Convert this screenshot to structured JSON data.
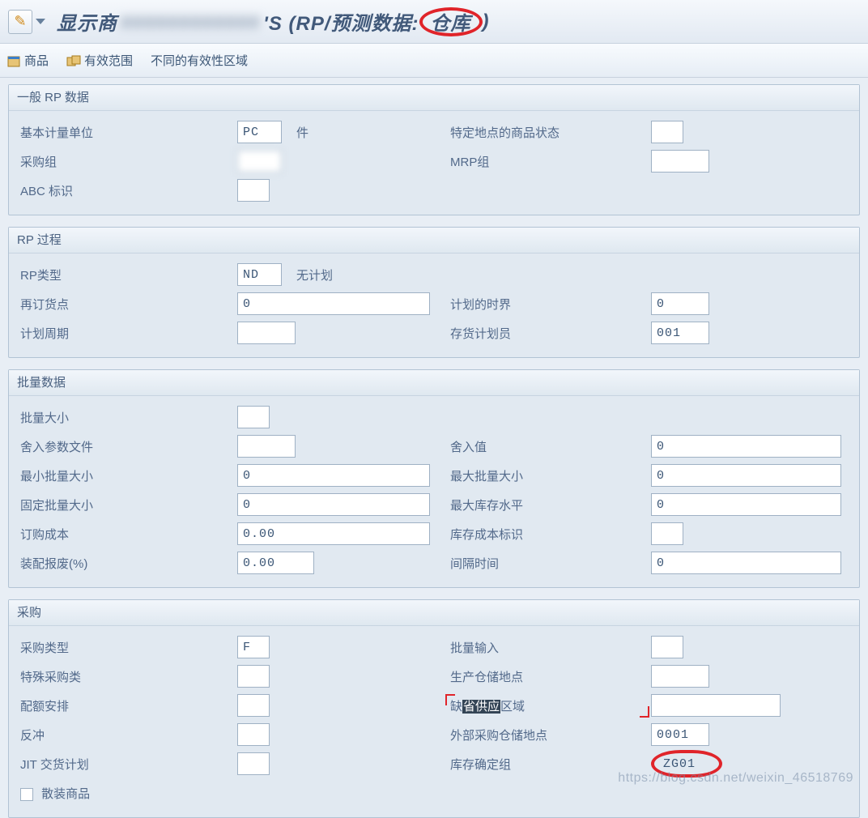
{
  "title": {
    "prefix": "显示商",
    "blurred": "xxxxxxxxxxxx",
    "suffix_before_circle": "'S (RP/预测数据: ",
    "circled": "仓库",
    "closing": ")"
  },
  "toolbar": {
    "product": "商品",
    "valid_range": "有效范围",
    "diff_validity": "不同的有效性区域"
  },
  "group_general": {
    "title": "一般 RP 数据",
    "base_uom_label": "基本计量单位",
    "base_uom_value": "PC",
    "base_uom_desc": "件",
    "site_status_label": "特定地点的商品状态",
    "site_status_value": "",
    "purch_group_label": "采购组",
    "purch_group_value": "",
    "mrp_group_label": "MRP组",
    "mrp_group_value": "",
    "abc_label": "ABC 标识",
    "abc_value": ""
  },
  "group_rp": {
    "title": "RP 过程",
    "rp_type_label": "RP类型",
    "rp_type_value": "ND",
    "rp_type_desc": "无计划",
    "reorder_label": "再订货点",
    "reorder_value": "0",
    "plan_horizon_label": "计划的时界",
    "plan_horizon_value": "0",
    "plan_cycle_label": "计划周期",
    "plan_cycle_value": "",
    "stock_planner_label": "存货计划员",
    "stock_planner_value": "001"
  },
  "group_lot": {
    "title": "批量数据",
    "lot_size_label": "批量大小",
    "lot_size_value": "",
    "round_profile_label": "舍入参数文件",
    "round_profile_value": "",
    "round_value_label": "舍入值",
    "round_value_value": "0",
    "min_lot_label": "最小批量大小",
    "min_lot_value": "0",
    "max_lot_label": "最大批量大小",
    "max_lot_value": "0",
    "fixed_lot_label": "固定批量大小",
    "fixed_lot_value": "0",
    "max_inv_label": "最大库存水平",
    "max_inv_value": "0",
    "order_cost_label": "订购成本",
    "order_cost_value": "0.00",
    "inv_cost_label": "库存成本标识",
    "inv_cost_value": "",
    "scrap_label": "装配报废(%)",
    "scrap_value": "0.00",
    "interval_label": "间隔时间",
    "interval_value": "0"
  },
  "group_purch": {
    "title": "采购",
    "purch_type_label": "采购类型",
    "purch_type_value": "F",
    "batch_input_label": "批量输入",
    "batch_input_value": "",
    "special_proc_label": "特殊采购类",
    "special_proc_value": "",
    "prod_loc_label": "生产仓储地点",
    "prod_loc_value": "",
    "quota_label": "配额安排",
    "quota_value": "",
    "supply_area_label_pre": "缺",
    "supply_area_label_hl": "省供应",
    "supply_area_label_post": "区域",
    "supply_area_value": "",
    "backflush_label": "反冲",
    "backflush_value": "",
    "ext_proc_loc_label": "外部采购仓储地点",
    "ext_proc_loc_value": "0001",
    "jit_label": "JIT 交货计划",
    "jit_value": "",
    "stock_det_label": "库存确定组",
    "stock_det_value": "ZG01",
    "bulk_label": "散装商品"
  },
  "watermark": "https://blog.csdn.net/weixin_46518769"
}
